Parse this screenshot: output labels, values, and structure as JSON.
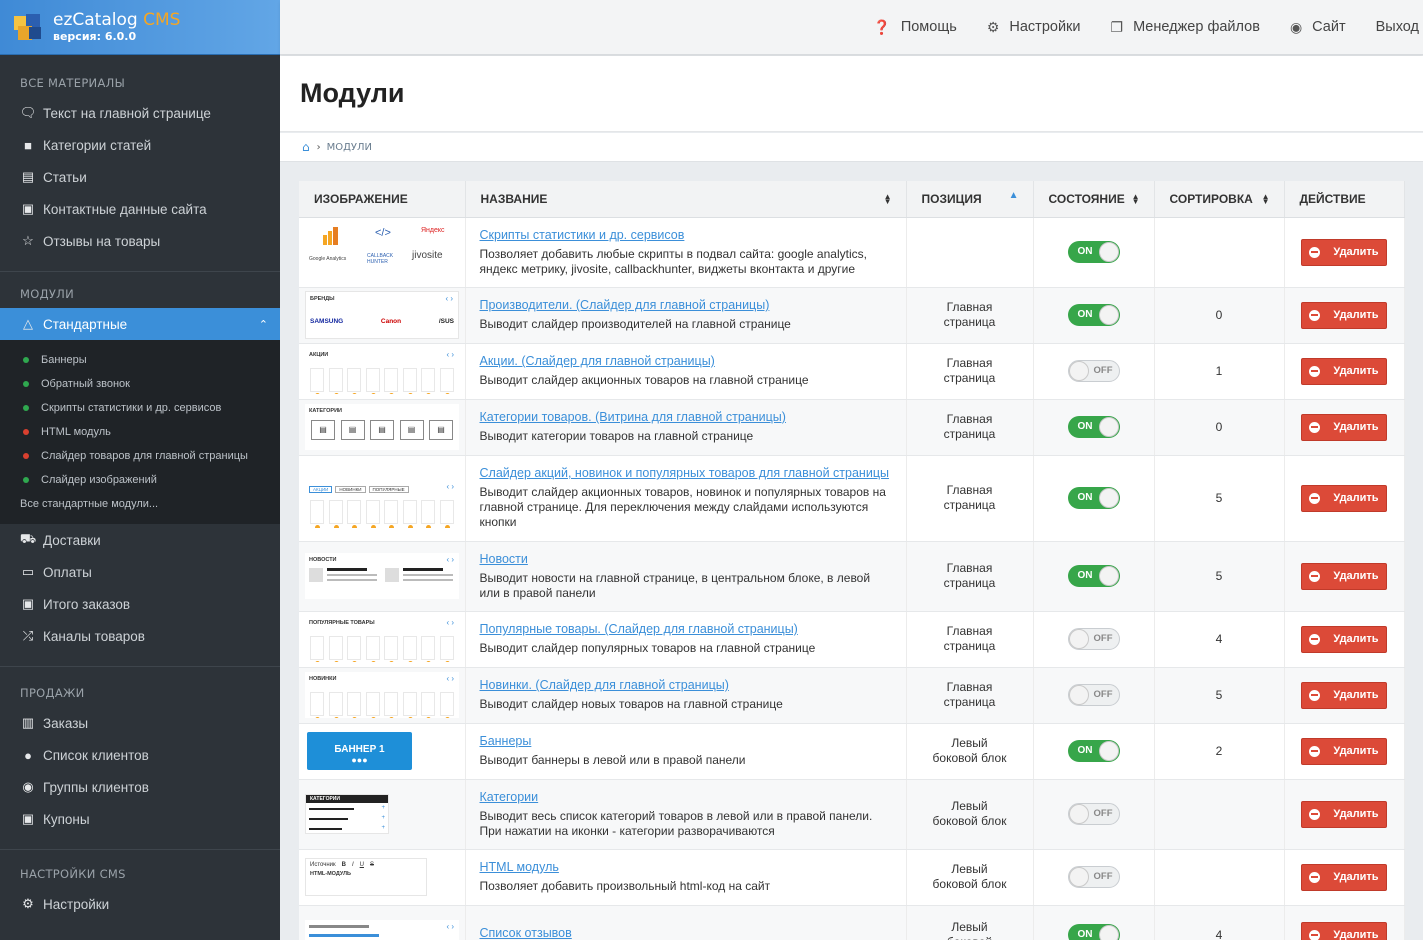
{
  "app": {
    "name": "ezCatalog",
    "name_suffix": "CMS",
    "version": "версия: 6.0.0"
  },
  "topbar": {
    "items": [
      {
        "label": "Помощь",
        "icon": "question-icon"
      },
      {
        "label": "Настройки",
        "icon": "gear-icon"
      },
      {
        "label": "Менеджер файлов",
        "icon": "files-icon"
      },
      {
        "label": "Сайт",
        "icon": "globe-icon"
      },
      {
        "label": "Выход",
        "icon": ""
      }
    ]
  },
  "sidebar": {
    "sections": [
      {
        "title": "ВСЕ МАТЕРИАЛЫ",
        "items": [
          "Текст на главной странице",
          "Категории статей",
          "Статьи",
          "Контактные данные сайта",
          "Отзывы на товары"
        ]
      },
      {
        "title": "МОДУЛИ",
        "active": "Стандартные",
        "subitems": [
          {
            "label": "Баннеры",
            "status": "green"
          },
          {
            "label": "Обратный звонок",
            "status": "green"
          },
          {
            "label": "Скрипты статистики и др. сервисов",
            "status": "green"
          },
          {
            "label": "HTML модуль",
            "status": "red"
          },
          {
            "label": "Слайдер товаров для главной страницы",
            "status": "red"
          },
          {
            "label": "Слайдер изображений",
            "status": "green"
          }
        ],
        "all_link": "Все стандартные модули...",
        "items": [
          "Доставки",
          "Оплаты",
          "Итого заказов",
          "Каналы товаров"
        ]
      },
      {
        "title": "ПРОДАЖИ",
        "items": [
          "Заказы",
          "Список клиентов",
          "Группы клиентов",
          "Купоны"
        ]
      },
      {
        "title": "НАСТРОЙКИ CMS",
        "items": [
          "Настройки"
        ]
      }
    ]
  },
  "page": {
    "title": "Модули",
    "breadcrumb": "МОДУЛИ"
  },
  "table": {
    "headers": [
      "ИЗОБРАЖЕНИЕ",
      "НАЗВАНИЕ",
      "ПОЗИЦИЯ",
      "СОСТОЯНИЕ",
      "СОРТИРОВКА",
      "ДЕЙСТВИЕ"
    ],
    "delete_label": "Удалить",
    "rows": [
      {
        "thumb": "services",
        "name": "Скрипты статистики и др. сервисов",
        "desc": "Позволяет добавить любые скрипты в подвал сайта: google analytics, яндекс метрику, jivosite, callbackhunter, виджеты вконтакта и другие",
        "pos": "",
        "state": "ON",
        "sort": ""
      },
      {
        "thumb": "brands",
        "thumb_title": "БРЕНДЫ",
        "name": "Производители. (Слайдер для главной страницы)",
        "desc": "Выводит слайдер производителей на главной странице",
        "pos": "Главная страница",
        "state": "ON",
        "sort": "0"
      },
      {
        "thumb": "products",
        "thumb_title": "АКЦИИ",
        "name": "Акции. (Слайдер для главной страницы)",
        "desc": "Выводит слайдер акционных товаров на главной странице",
        "pos": "Главная страница",
        "state": "OFF",
        "sort": "1"
      },
      {
        "thumb": "categories",
        "thumb_title": "КАТЕГОРИИ",
        "name": "Категории товаров. (Витрина для главной страницы)",
        "desc": "Выводит категории товаров на главной странице",
        "pos": "Главная страница",
        "state": "ON",
        "sort": "0"
      },
      {
        "thumb": "tabs",
        "thumb_tabs": [
          "АКЦИИ",
          "НОВИНКИ",
          "ПОПУЛЯРНЫЕ"
        ],
        "name": "Слайдер акций, новинок и популярных товаров для главной страницы",
        "desc": "Выводит слайдер акционных товаров, новинок и популярных товаров на главной странице. Для переключения между слайдами используются кнопки",
        "pos": "Главная страница",
        "state": "ON",
        "sort": "5"
      },
      {
        "thumb": "news",
        "thumb_title": "НОВОСТИ",
        "name": "Новости",
        "desc": "Выводит новости на главной странице, в центральном блоке, в левой или в правой панели",
        "pos": "Главная страница",
        "state": "ON",
        "sort": "5"
      },
      {
        "thumb": "products",
        "thumb_title": "ПОПУЛЯРНЫЕ ТОВАРЫ",
        "name": "Популярные товары. (Слайдер для главной страницы)",
        "desc": "Выводит слайдер популярных товаров на главной странице",
        "pos": "Главная страница",
        "state": "OFF",
        "sort": "4"
      },
      {
        "thumb": "products",
        "thumb_title": "НОВИНКИ",
        "name": "Новинки. (Слайдер для главной страницы)",
        "desc": "Выводит слайдер новых товаров на главной странице",
        "pos": "Главная страница",
        "state": "OFF",
        "sort": "5"
      },
      {
        "thumb": "banner",
        "thumb_title": "БАННЕР 1",
        "name": "Баннеры",
        "desc": "Выводит баннеры в левой или в правой панели",
        "pos": "Левый боковой блок",
        "state": "ON",
        "sort": "2"
      },
      {
        "thumb": "catlist",
        "thumb_title": "КАТЕГОРИИ",
        "name": "Категории",
        "desc": "Выводит весь список категорий товаров в левой или в правой панели. При нажатии на иконки - категории разворачиваются",
        "pos": "Левый боковой блок",
        "state": "OFF",
        "sort": ""
      },
      {
        "thumb": "html",
        "thumb_title": "HTML-МОДУЛЬ",
        "thumb_source": "Источник",
        "name": "HTML модуль",
        "desc": "Позволяет добавить произвольный html-код на сайт",
        "pos": "Левый боковой блок",
        "state": "OFF",
        "sort": ""
      },
      {
        "thumb": "reviews",
        "name": "Список отзывов",
        "desc": "",
        "pos": "Левый боковой",
        "state": "ON",
        "sort": "4"
      }
    ]
  },
  "thumb_services": {
    "ga": "Google Analytics",
    "cb": "CALLBACK HUNTER",
    "ya": "Яндекс",
    "jv": "jivosite"
  },
  "thumb_brands": [
    "SAMSUNG",
    "Canon",
    "/SUS"
  ],
  "colors": {
    "accent": "#3b8fd9",
    "sidebar": "#2d3339",
    "on": "#37a64a",
    "delete": "#dc4a38",
    "dot_green": "#2fa84f",
    "dot_red": "#d9402f"
  }
}
